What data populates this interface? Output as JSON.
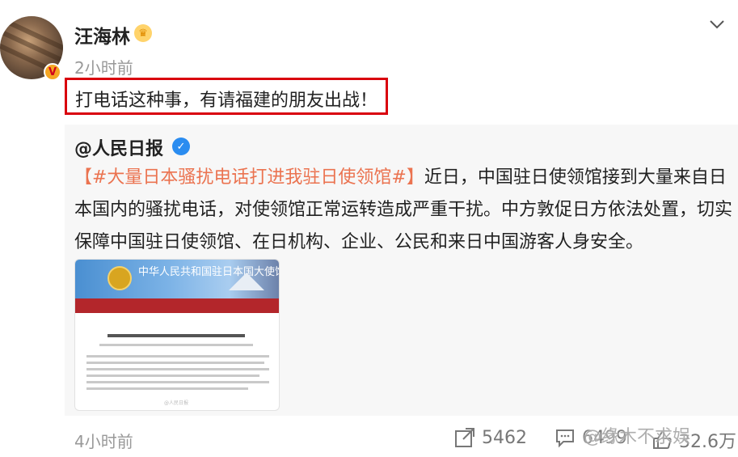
{
  "post": {
    "username": "汪海林",
    "time": "2小时前",
    "text": "打电话这种事，有请福建的朋友出战！"
  },
  "repost": {
    "author": "@人民日报",
    "topic": "【#大量日本骚扰电话打进我驻日使领馆#】",
    "body": "近日，中国驻日使领馆接到大量来自日本国内的骚扰电话，对使领馆正常运转造成严重干扰。中方敦促日方依法处置，切实保障中国驻日使领馆、在日机构、企业、公民和来日中国游客人身安全。",
    "image": {
      "banner_title": "中华人民共和国驻日本国大使馆",
      "watermark": "@人民日报"
    }
  },
  "footer": {
    "time": "4小时前",
    "shares": "5462",
    "comments": "6499",
    "likes": "32.6万"
  },
  "overlay_watermark": "@缘木不求娱",
  "colors": {
    "highlight_border": "#d9000d",
    "topic": "#eb7350",
    "verified": "#2a8cf0"
  },
  "icons": [
    "chevron-down-icon",
    "crown-badge-icon",
    "verified-v-icon",
    "share-icon",
    "comment-icon",
    "like-icon"
  ]
}
